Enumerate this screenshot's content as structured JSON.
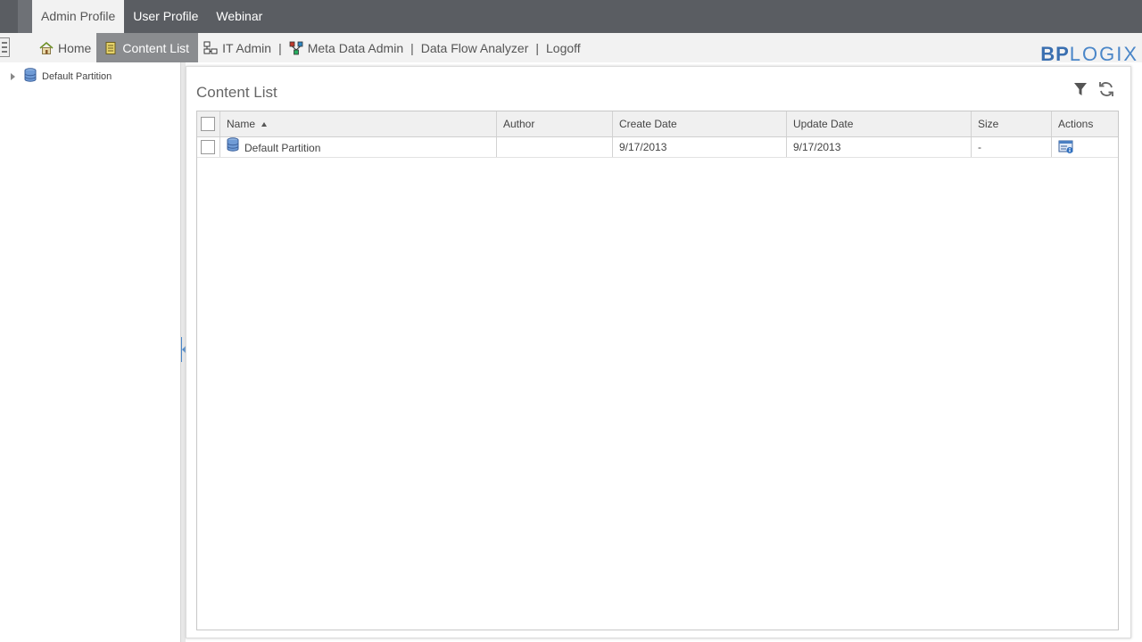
{
  "profile_bar": {
    "tabs": [
      {
        "label": "Admin Profile",
        "active": true
      },
      {
        "label": "User Profile",
        "active": false
      },
      {
        "label": "Webinar",
        "active": false
      }
    ]
  },
  "nav": {
    "items": [
      {
        "label": "Home",
        "icon": "home-icon",
        "active": false
      },
      {
        "label": "Content List",
        "icon": "content-list-icon",
        "active": true
      },
      {
        "label": "IT Admin",
        "icon": "it-admin-icon",
        "active": false
      },
      {
        "label": "Meta Data Admin",
        "icon": "meta-data-icon",
        "active": false
      },
      {
        "label": "Data Flow Analyzer",
        "active": false
      },
      {
        "label": "Logoff",
        "active": false
      }
    ],
    "separator": "|"
  },
  "logo": {
    "part1": "BP",
    "part2": "LOGIX"
  },
  "tree": {
    "nodes": [
      {
        "label": "Default Partition",
        "icon": "database-icon"
      }
    ]
  },
  "main": {
    "title": "Content List",
    "tools": [
      "filter-icon",
      "refresh-icon"
    ]
  },
  "grid": {
    "columns": {
      "name": "Name",
      "author": "Author",
      "create_date": "Create Date",
      "update_date": "Update Date",
      "size": "Size",
      "actions": "Actions"
    },
    "sort": {
      "column": "Name",
      "direction": "ascending"
    },
    "rows": [
      {
        "name": "Default Partition",
        "author": "",
        "create_date": "9/17/2013",
        "update_date": "9/17/2013",
        "size": "-",
        "action_icon": "properties-icon"
      }
    ]
  },
  "colors": {
    "topbar": "#5a5d62",
    "navbar": "#f2f2f2",
    "active_nav": "#8a8c8f",
    "logo_blue": "#3a6fb0"
  }
}
